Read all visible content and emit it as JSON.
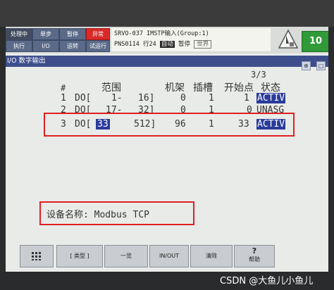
{
  "status": {
    "b1": "处理中",
    "b2": "单步",
    "b3": "暂停",
    "b4": "异常",
    "b5": "执行",
    "b6": "I/O",
    "b7": "运转",
    "b8": "试运行"
  },
  "message": {
    "line1": "SRVO-037 IMSTP输入(Group:1)",
    "program": "PNS0114",
    "line": "行24",
    "mode": "自动",
    "state": "暂停",
    "edge": "世界"
  },
  "indicator_value": "10",
  "title": "I/O 数字输出",
  "page_indicator": "3/3",
  "headers": {
    "num": "#",
    "range": "范围",
    "rack": "机架",
    "slot": "插槽",
    "start": "开始点",
    "status": "状态"
  },
  "rows": [
    {
      "num": "1",
      "type": "DO[",
      "r1": "1-",
      "r2": "16]",
      "rack": "0",
      "slot": "1",
      "start": "1",
      "status": "ACTIV"
    },
    {
      "num": "2",
      "type": "DO[",
      "r1": "17-",
      "r2": "32]",
      "rack": "0",
      "slot": "1",
      "start": "0",
      "status": "UNASG"
    },
    {
      "num": "3",
      "type": "DO[",
      "r1": "33",
      "r2": "512]",
      "rack": "96",
      "slot": "1",
      "start": "33",
      "status": "ACTIV"
    }
  ],
  "device_name": "设备名称: Modbus TCP",
  "fkeys": {
    "f1": "[ 类型 ]",
    "f2": "一览",
    "f3": "IN/OUT",
    "f4": "清除",
    "f5": "帮助"
  },
  "watermark": "CSDN @大鱼儿小鱼儿"
}
